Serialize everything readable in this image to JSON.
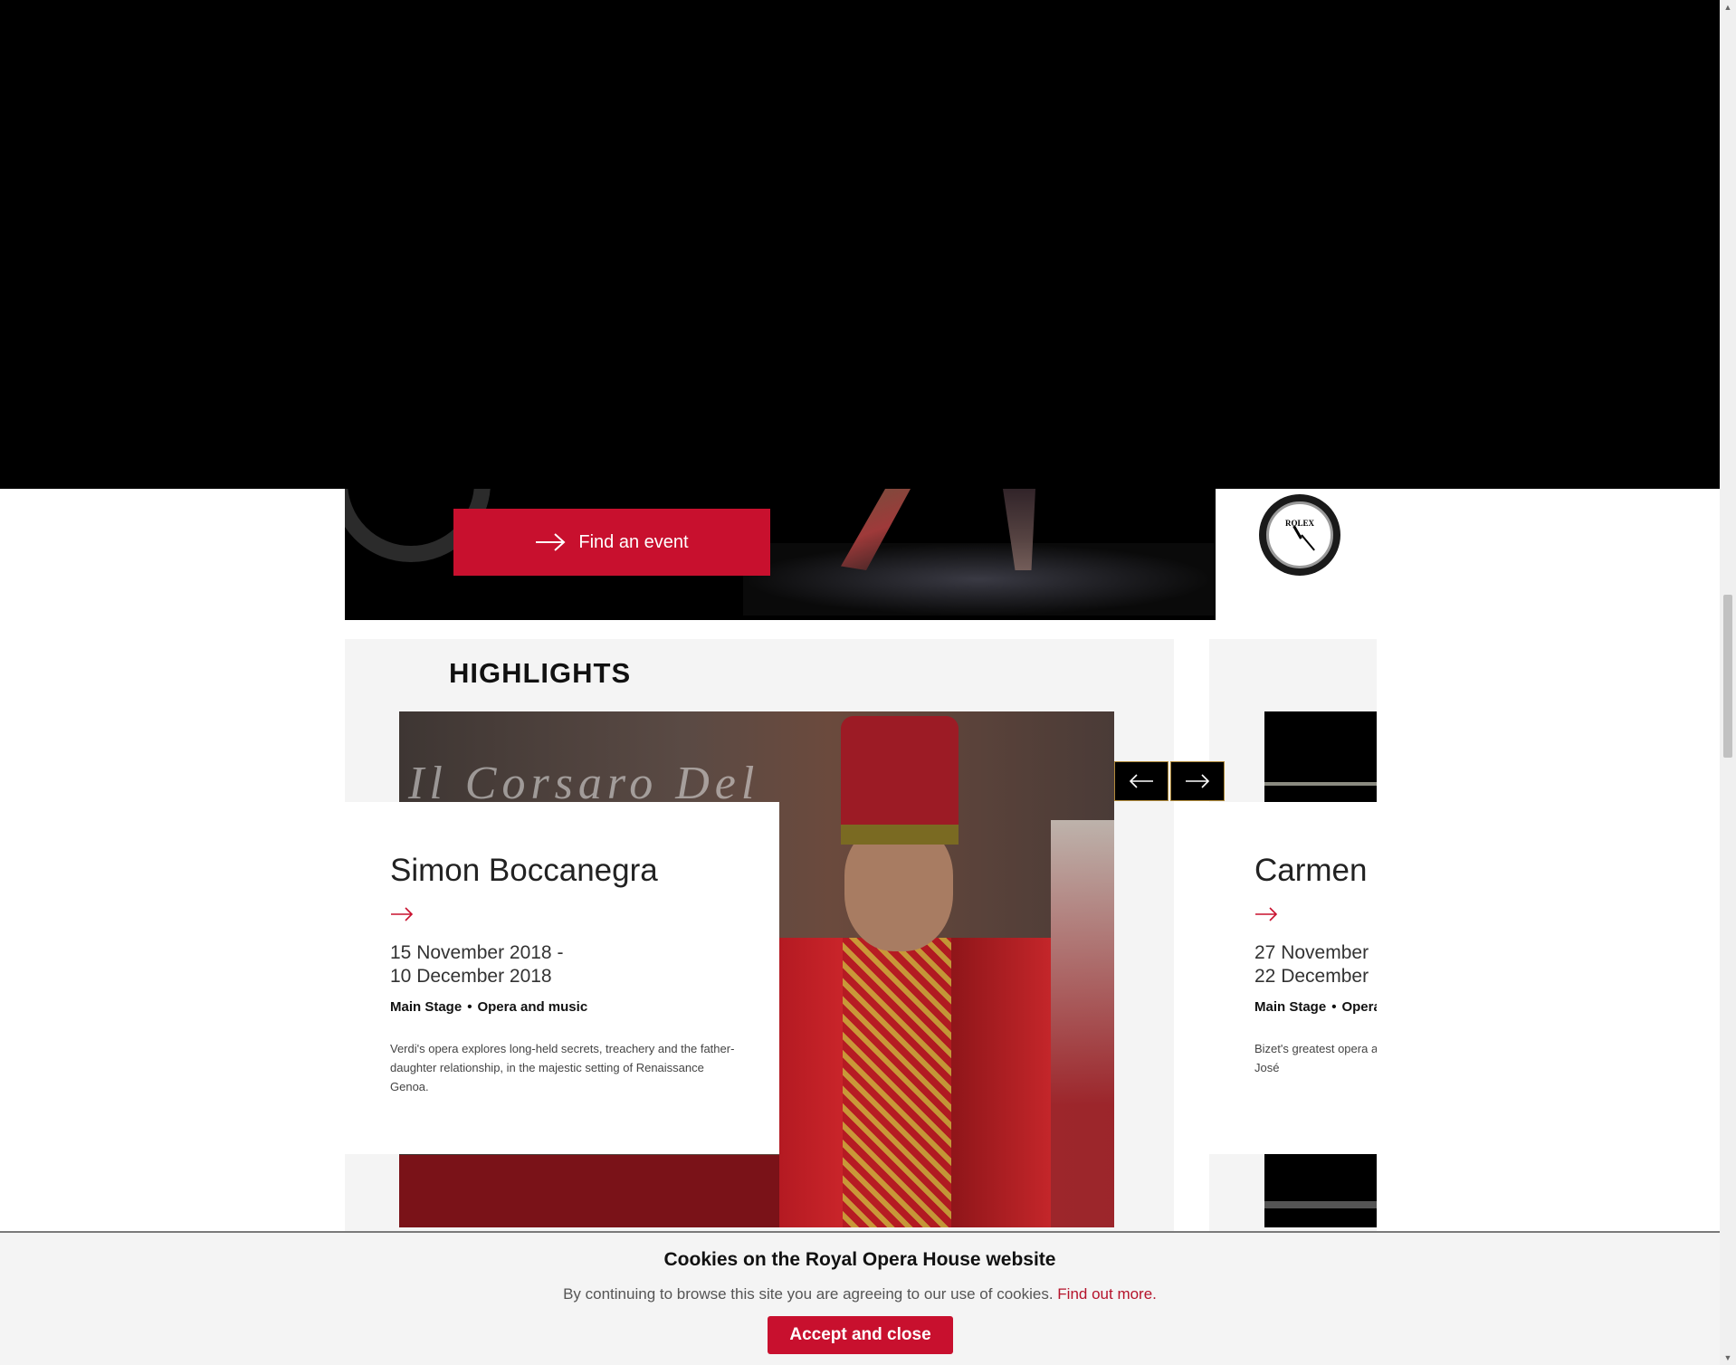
{
  "hero": {
    "find_event_label": "Find an event"
  },
  "sponsor": {
    "clock_brand": "ROLEX"
  },
  "highlights": {
    "heading": "HIGHLIGHTS",
    "events": [
      {
        "title": "Simon Boccanegra",
        "date_start": "15 November 2018 -",
        "date_end": "10 December 2018",
        "venue": "Main Stage",
        "category": "Opera and music",
        "description": "Verdi's opera explores long-held secrets, treachery and the father-daughter relationship, in the majestic setting of Renaissance Genoa."
      },
      {
        "title": "Carmen",
        "date_start": "27 November",
        "date_end": "22 December",
        "venue": "Main Stage",
        "category": "Opera and music",
        "description": "Bizet's greatest opera and seductive Carmen arouses in Don José"
      }
    ]
  },
  "cookie_banner": {
    "title": "Cookies on the Royal Opera House website",
    "text": "By continuing to browse this site you are agreeing to our use of cookies.",
    "link": "Find out more.",
    "accept_label": "Accept and close"
  },
  "colors": {
    "brand_red": "#c8102e",
    "panel_grey": "#f4f4f4"
  }
}
